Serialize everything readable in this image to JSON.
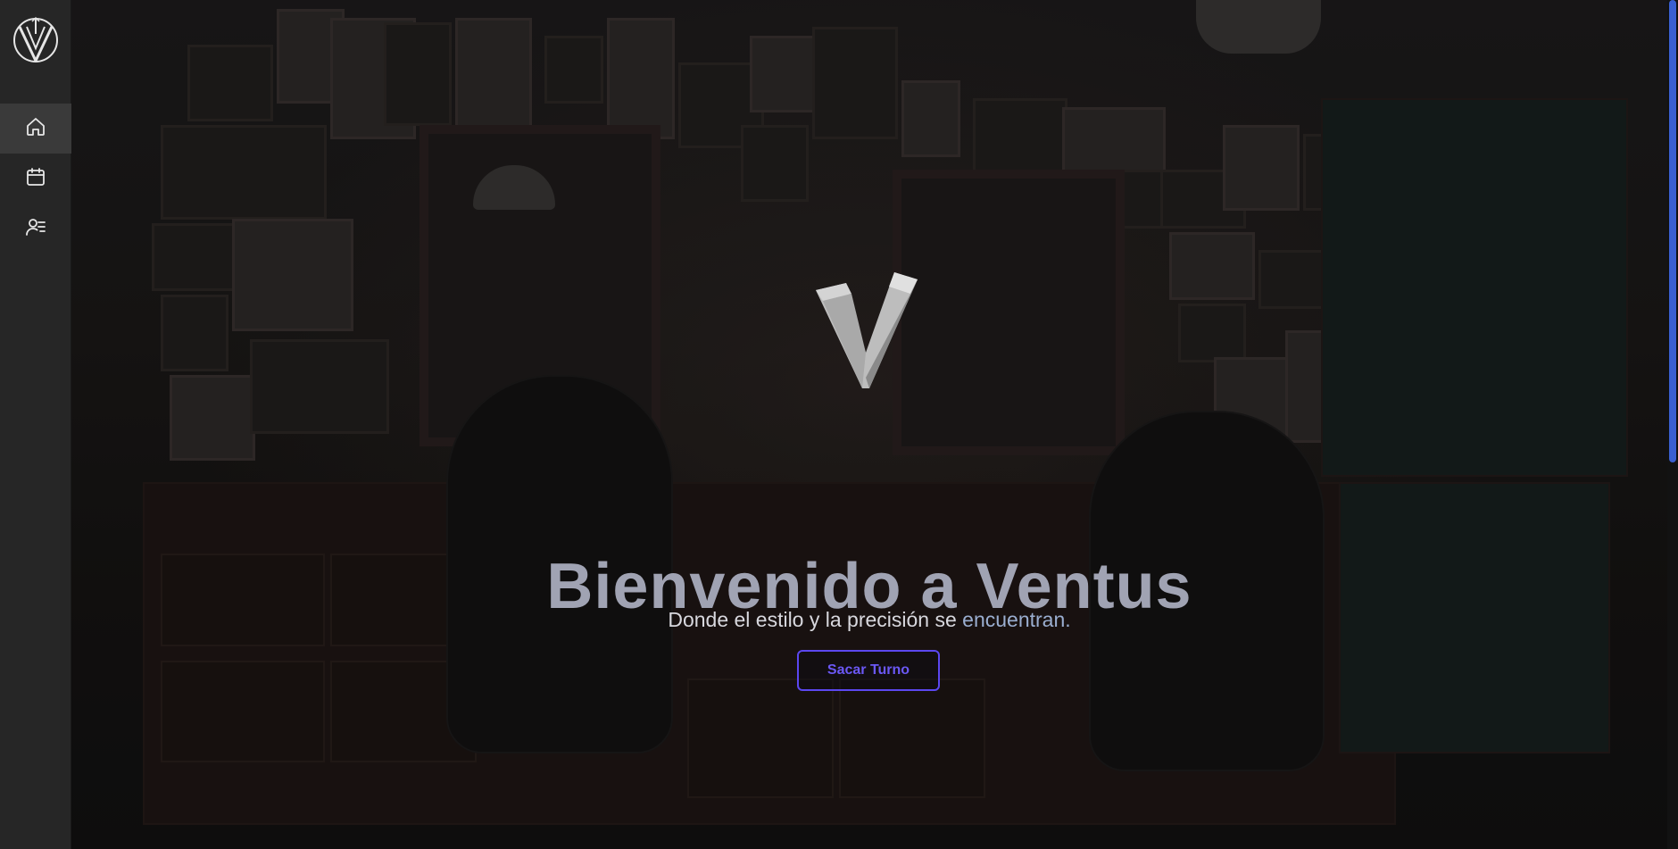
{
  "sidebar": {
    "logo_icon": "ventus-logo-icon",
    "items": [
      {
        "icon": "home-icon",
        "active": true
      },
      {
        "icon": "calendar-icon",
        "active": false
      },
      {
        "icon": "user-list-icon",
        "active": false
      }
    ]
  },
  "hero": {
    "logo_icon": "ventus-3d-v-logo",
    "title": "Bienvenido a Ventus",
    "subtitle_main": "Donde el estilo y la precisión se ",
    "subtitle_accent": "encuentran",
    "subtitle_end": ".",
    "cta_label": "Sacar Turno"
  },
  "colors": {
    "accent": "#5b47f0",
    "title": "#a0a3b3",
    "sidebar_bg": "#262626",
    "scroll_thumb": "#3a5fd1"
  }
}
